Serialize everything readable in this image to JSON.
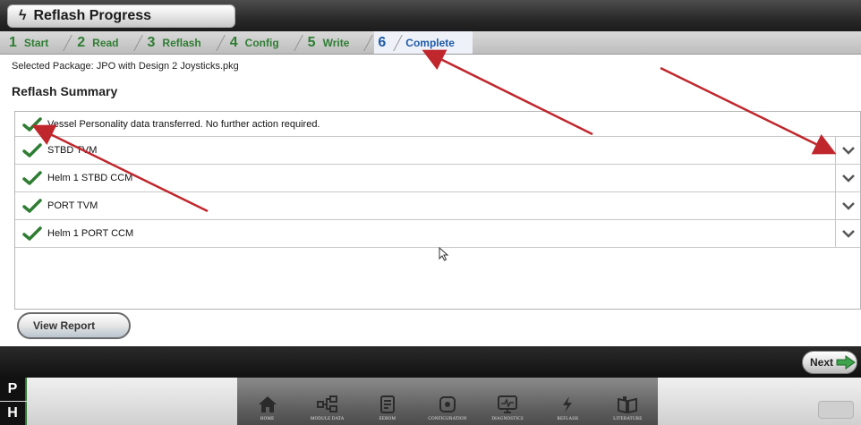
{
  "window": {
    "title": "Reflash Progress"
  },
  "steps": [
    {
      "num": "1",
      "label": "Start"
    },
    {
      "num": "2",
      "label": "Read"
    },
    {
      "num": "3",
      "label": "Reflash"
    },
    {
      "num": "4",
      "label": "Config"
    },
    {
      "num": "5",
      "label": "Write"
    },
    {
      "num": "6",
      "label": "Complete",
      "active": true
    }
  ],
  "package_line": "Selected Package: JPO with Design 2 Joysticks.pkg",
  "summary_title": "Reflash Summary",
  "summary_rows": [
    {
      "text": "Vessel Personality data transferred.  No further action required.",
      "status": "ok",
      "expandable": false
    },
    {
      "text": "STBD TVM",
      "status": "ok",
      "expandable": true
    },
    {
      "text": "Helm 1 STBD CCM",
      "status": "ok",
      "expandable": true
    },
    {
      "text": "PORT TVM",
      "status": "ok",
      "expandable": true
    },
    {
      "text": "Helm 1 PORT CCM",
      "status": "ok",
      "expandable": true
    }
  ],
  "buttons": {
    "view_report": "View Report",
    "next": "Next"
  },
  "side_letters": {
    "p": "P",
    "h": "H"
  },
  "nav": [
    {
      "label": "HOME",
      "icon": "home-icon"
    },
    {
      "label": "MODULE DATA",
      "icon": "module-data-icon"
    },
    {
      "label": "EEROM",
      "icon": "eerom-icon"
    },
    {
      "label": "CONFIGURATION",
      "icon": "configuration-icon"
    },
    {
      "label": "DIAGNOSTICS",
      "icon": "diagnostics-icon"
    },
    {
      "label": "REFLASH",
      "icon": "reflash-icon"
    },
    {
      "label": "LITERATURE",
      "icon": "literature-icon"
    }
  ],
  "colors": {
    "check_green": "#2e7d32",
    "active_step": "#1e5aa8",
    "annotation_arrow": "#c0272d"
  }
}
